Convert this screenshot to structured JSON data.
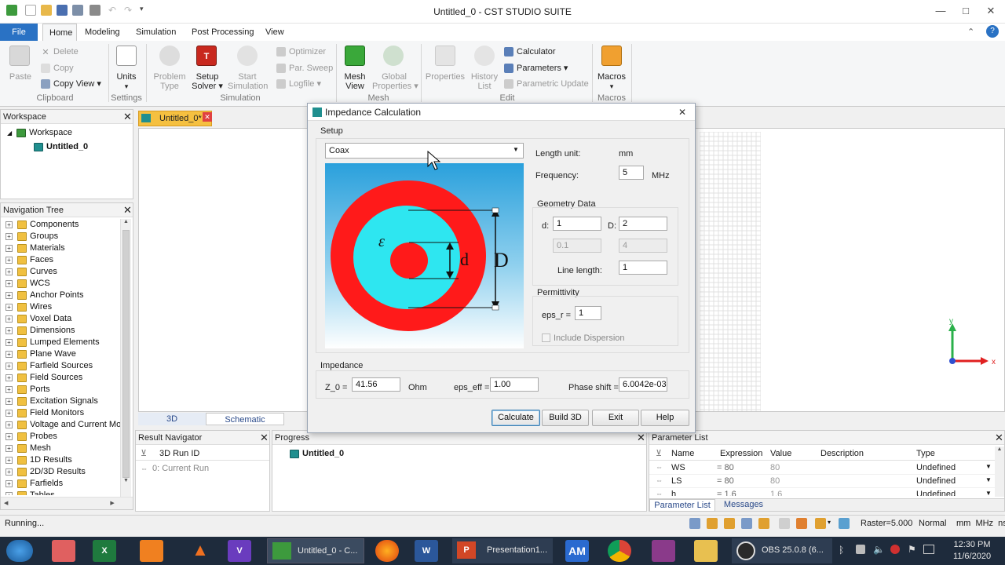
{
  "window": {
    "title": "Untitled_0 - CST STUDIO SUITE",
    "minimize": "—",
    "maximize": "□",
    "close": "✕"
  },
  "ribbon_tabs": [
    "File",
    "Home",
    "Modeling",
    "Simulation",
    "Post Processing",
    "View"
  ],
  "ribbon": {
    "clipboard": {
      "paste": "Paste",
      "delete": "Delete",
      "copy": "Copy",
      "copy_view": "Copy View ▾",
      "group": "Clipboard"
    },
    "settings": {
      "units": "Units",
      "group": "Settings"
    },
    "simulation": {
      "problem_type": "Problem\nType",
      "setup_solver": "Setup\nSolver ▾",
      "start_simulation": "Start\nSimulation",
      "optimizer": "Optimizer",
      "par_sweep": "Par. Sweep",
      "logfile": "Logfile ▾",
      "group": "Simulation"
    },
    "mesh": {
      "mesh_view": "Mesh\nView",
      "global_properties": "Global\nProperties ▾",
      "group": "Mesh"
    },
    "edit": {
      "properties": "Properties",
      "history_list": "History\nList",
      "calculator": "Calculator",
      "parameters": "Parameters ▾",
      "parametric_update": "Parametric Update",
      "group": "Edit"
    },
    "macros": {
      "macros": "Macros",
      "group": "Macros"
    }
  },
  "workspace": {
    "header": "Workspace",
    "root": "Workspace",
    "child": "Untitled_0"
  },
  "doc_tab": {
    "label": "Untitled_0*"
  },
  "nav_tree": {
    "header": "Navigation Tree",
    "items": [
      "Components",
      "Groups",
      "Materials",
      "Faces",
      "Curves",
      "WCS",
      "Anchor Points",
      "Wires",
      "Voxel Data",
      "Dimensions",
      "Lumped Elements",
      "Plane Wave",
      "Farfield Sources",
      "Field Sources",
      "Ports",
      "Excitation Signals",
      "Field Monitors",
      "Voltage and Current Mon",
      "Probes",
      "Mesh",
      "1D Results",
      "2D/3D Results",
      "Farfields",
      "Tables"
    ]
  },
  "view_tabs": [
    "3D",
    "Schematic"
  ],
  "result_navigator": {
    "header": "Result Navigator",
    "column": "3D Run ID",
    "row": "0: Current Run"
  },
  "progress": {
    "header": "Progress",
    "item": "Untitled_0"
  },
  "parameter_list": {
    "header": "Parameter List",
    "columns": [
      "Name",
      "Expression",
      "Value",
      "Description",
      "Type"
    ],
    "rows": [
      {
        "name": "WS",
        "expression": "= 80",
        "value": "80",
        "description": "",
        "type": "Undefined"
      },
      {
        "name": "LS",
        "expression": "= 80",
        "value": "80",
        "description": "",
        "type": "Undefined"
      },
      {
        "name": "h",
        "expression": "= 1.6",
        "value": "1.6",
        "description": "",
        "type": "Undefined"
      }
    ],
    "tabs": [
      "Parameter List",
      "Messages"
    ]
  },
  "dialog": {
    "title": "Impedance Calculation",
    "setup_label": "Setup",
    "type_select": "Coax",
    "length_unit_label": "Length unit:",
    "length_unit": "mm",
    "frequency_label": "Frequency:",
    "frequency": "5",
    "frequency_unit": "MHz",
    "geometry_label": "Geometry Data",
    "d_label": "d:",
    "d_value": "1",
    "D_label": "D:",
    "D_value": "2",
    "d_lower": "0.1",
    "D_lower": "4",
    "line_length_label": "Line length:",
    "line_length": "1",
    "permittivity_label": "Permittivity",
    "eps_r_label": "eps_r =",
    "eps_r": "1",
    "include_dispersion": "Include Dispersion",
    "impedance_label": "Impedance",
    "z0_label": "Z_0 =",
    "z0": "41.56",
    "z0_unit": "Ohm",
    "eps_eff_label": "eps_eff =",
    "eps_eff": "1.00",
    "phase_shift_label": "Phase shift =",
    "phase_shift": "6.0042e-03",
    "diagram": {
      "eps": "ε",
      "d": "d",
      "D": "D"
    },
    "buttons": {
      "calculate": "Calculate",
      "build3d": "Build 3D",
      "exit": "Exit",
      "help": "Help"
    }
  },
  "status_bar": {
    "left": "Running...",
    "raster": "Raster=5.000",
    "normal": "Normal",
    "units": "mm  MHz  ns  K"
  },
  "taskbar": {
    "cst_app": "Untitled_0 - C...",
    "powerpoint": "Presentation1...",
    "am": "AM",
    "obs": "OBS 25.0.8 (6...",
    "time": "12:30 PM",
    "date": "11/6/2020"
  },
  "colors": {
    "accent": "#2a72c4",
    "coax_outer": "#ff1a1a",
    "coax_dielectric": "#2ee6f0",
    "diagram_bg": "#2aa8e0"
  }
}
